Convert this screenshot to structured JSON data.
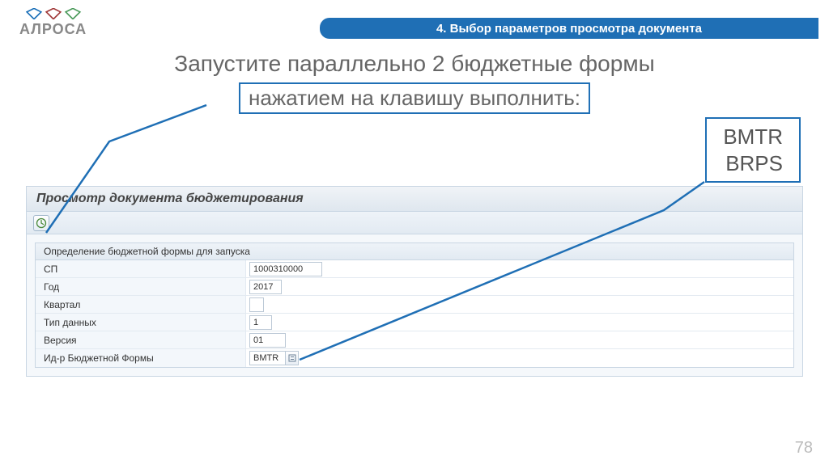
{
  "brand": {
    "name": "АЛРОСА"
  },
  "header": {
    "title": "4. Выбор параметров просмотра документа"
  },
  "instruction": {
    "line1": "Запустите параллельно 2 бюджетные формы",
    "line2": "нажатием на клавишу выполнить:"
  },
  "codes": {
    "line1": "BMTR",
    "line2": "BRPS"
  },
  "sap": {
    "window_title": "Просмотр документа бюджетирования",
    "groupbox_title": "Определение бюджетной формы для запуска",
    "fields": {
      "sp": {
        "label": "СП",
        "value": "1000310000"
      },
      "year": {
        "label": "Год",
        "value": "2017"
      },
      "quarter": {
        "label": "Квартал",
        "value": ""
      },
      "datatype": {
        "label": "Тип данных",
        "value": "1"
      },
      "version": {
        "label": "Версия",
        "value": "01"
      },
      "formid": {
        "label": "Ид-р Бюджетной Формы",
        "value": "BMTR"
      }
    }
  },
  "page": {
    "number": "78"
  }
}
